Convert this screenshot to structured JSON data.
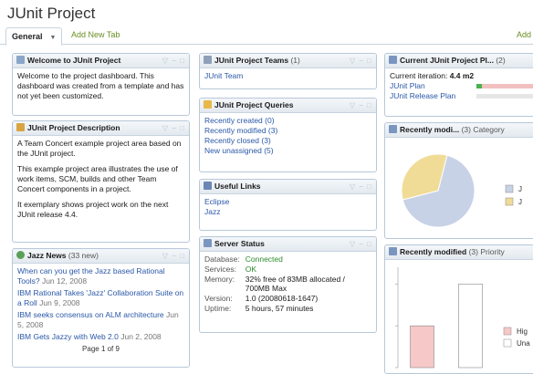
{
  "page_title": "JUnit Project",
  "tabs": {
    "active_label": "General",
    "add_label": "Add New Tab",
    "add_right_label": "Add"
  },
  "welcome": {
    "title": "Welcome to JUnit Project",
    "text": "Welcome to the project dashboard. This dashboard was created from a template and has not yet been customized."
  },
  "description": {
    "title": "JUnit Project Description",
    "p1": "A Team Concert example project area based on the JUnit project.",
    "p2": "This example project area illustrates the use of work items, SCM, builds and other Team Concert components in a project.",
    "p3": "It exemplary shows project work on the next JUnit release 4.4."
  },
  "news": {
    "title": "Jazz News",
    "count": "(33 new)",
    "items": [
      {
        "text": "When can you get the Jazz based Rational Tools?",
        "date": "Jun 12, 2008"
      },
      {
        "text": "IBM Rational Takes 'Jazz' Collaboration Suite on a Roll",
        "date": "Jun 9, 2008"
      },
      {
        "text": "IBM seeks consensus on ALM architecture",
        "date": "Jun 5, 2008"
      },
      {
        "text": "IBM Gets Jazzy with Web 2.0",
        "date": "Jun 2, 2008"
      }
    ],
    "pager": "Page 1 of 9"
  },
  "teams": {
    "title": "JUnit Project Teams",
    "count": "(1)",
    "items": [
      "JUnit Team"
    ]
  },
  "queries": {
    "title": "JUnit Project Queries",
    "items": [
      "Recently created (0)",
      "Recently modified (3)",
      "Recently closed (3)",
      "New unassigned (5)"
    ]
  },
  "useful_links": {
    "title": "Useful Links",
    "items": [
      "Eclipse",
      "Jazz"
    ]
  },
  "server_status": {
    "title": "Server Status",
    "rows": [
      {
        "key": "Database:",
        "value": "Connected",
        "status": true
      },
      {
        "key": "Services:",
        "value": "OK",
        "status": true
      },
      {
        "key": "Memory:",
        "value": "32% free of 83MB allocated / 700MB Max",
        "status": false
      },
      {
        "key": "Version:",
        "value": "1.0 (20080618-1647)",
        "status": false
      },
      {
        "key": "Uptime:",
        "value": "5 hours, 57 minutes",
        "status": false
      }
    ]
  },
  "current_plan": {
    "title": "Current JUnit Project Pl...",
    "count": "(2)",
    "iteration_label": "Current iteration:",
    "iteration_value": "4.4 m2",
    "plans": [
      {
        "name": "JUnit Plan",
        "done_fraction": 0.08
      },
      {
        "name": "JUnit Release Plan",
        "done_fraction": 0.0
      }
    ]
  },
  "recent_category": {
    "title": "Recently modi...",
    "subtitle": "(3) Category",
    "chart_data": {
      "type": "pie",
      "values": [
        67,
        33
      ],
      "colors": [
        "#c8d2e6",
        "#f0dc96"
      ],
      "legend": [
        "J",
        "J"
      ]
    }
  },
  "recent_priority": {
    "title": "Recently modified",
    "subtitle": "(3) Priority",
    "chart_data": {
      "type": "bar",
      "categories": [
        "High",
        "Unassigned"
      ],
      "values": [
        1,
        2
      ],
      "colors": [
        "#f6c8c8",
        "#ffffff"
      ],
      "ylim": [
        0,
        2.4
      ],
      "legend": [
        "Hig",
        "Una"
      ]
    }
  },
  "colors": {
    "accent": "#2a58a8",
    "ok": "#2e8b2e",
    "border": "#b8c8d8"
  }
}
